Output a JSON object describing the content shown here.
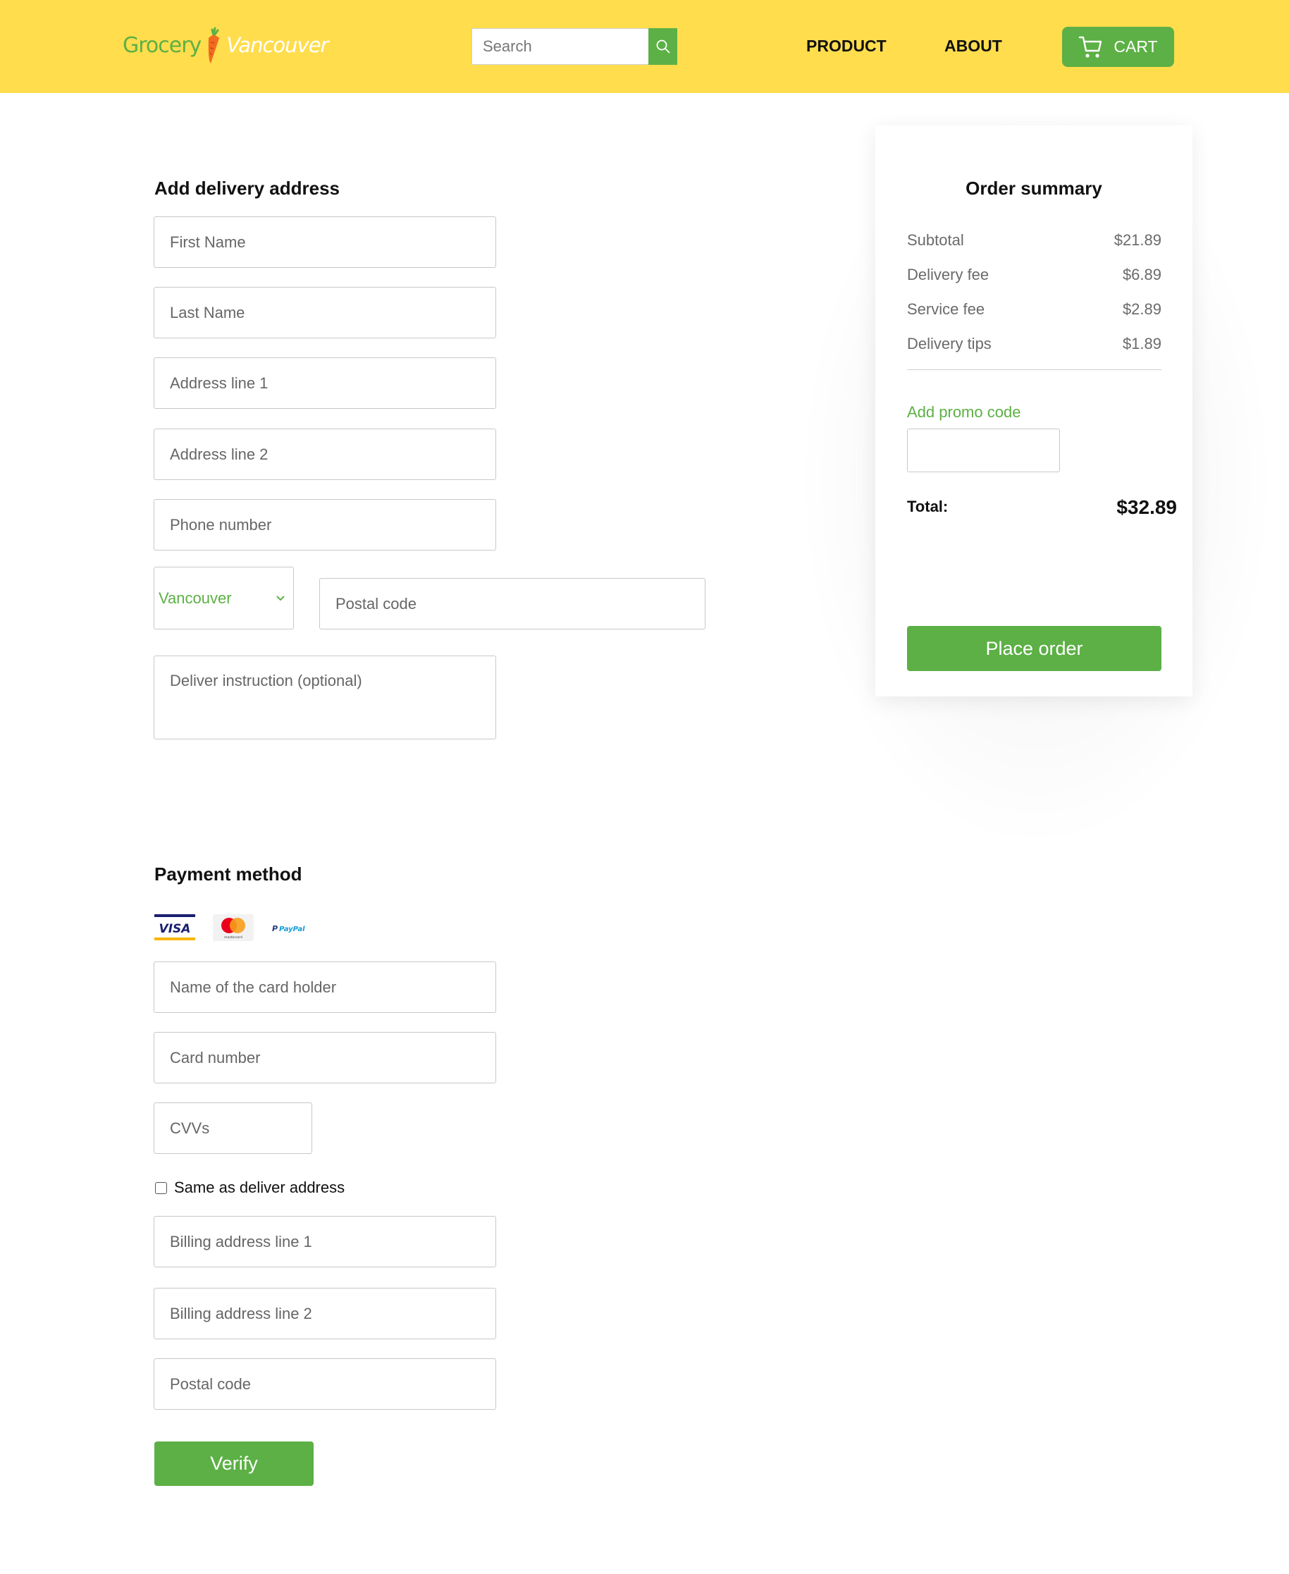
{
  "header": {
    "logo_left": "Grocery",
    "logo_right": "Vancouver",
    "search_placeholder": "Search",
    "nav": [
      "PRODUCT",
      "ABOUT"
    ],
    "cart_label": "CART"
  },
  "delivery": {
    "title": "Add delivery address",
    "first_name_placeholder": "First Name",
    "last_name_placeholder": "Last Name",
    "address1_placeholder": "Address line 1",
    "address2_placeholder": "Address line 2",
    "phone_placeholder": "Phone number",
    "city_selected": "Vancouver",
    "postal_placeholder": "Postal code",
    "instruction_placeholder": "Deliver instruction (optional)"
  },
  "payment": {
    "title": "Payment method",
    "logos": [
      "VISA",
      "mastercard",
      "PayPal"
    ],
    "card_holder_placeholder": "Name of the card holder",
    "card_number_placeholder": "Card number",
    "cvv_placeholder": "CVVs",
    "same_address_label": "Same as deliver address",
    "billing1_placeholder": "Billing address line 1",
    "billing2_placeholder": "Billing address line 2",
    "billing_postal_placeholder": "Postal code",
    "verify_label": "Verify"
  },
  "summary": {
    "title": "Order summary",
    "rows": [
      {
        "label": "Subtotal",
        "value": "$21.89"
      },
      {
        "label": "Delivery fee",
        "value": "$6.89"
      },
      {
        "label": "Service fee",
        "value": "$2.89"
      },
      {
        "label": "Delivery tips",
        "value": "$1.89"
      }
    ],
    "promo_label": "Add promo code",
    "total_label": "Total:",
    "total_value": "$32.89",
    "place_order_label": "Place order"
  },
  "colors": {
    "header_bg": "#ffdd4d",
    "accent_green": "#5cb045",
    "carrot_orange": "#f26b21"
  }
}
